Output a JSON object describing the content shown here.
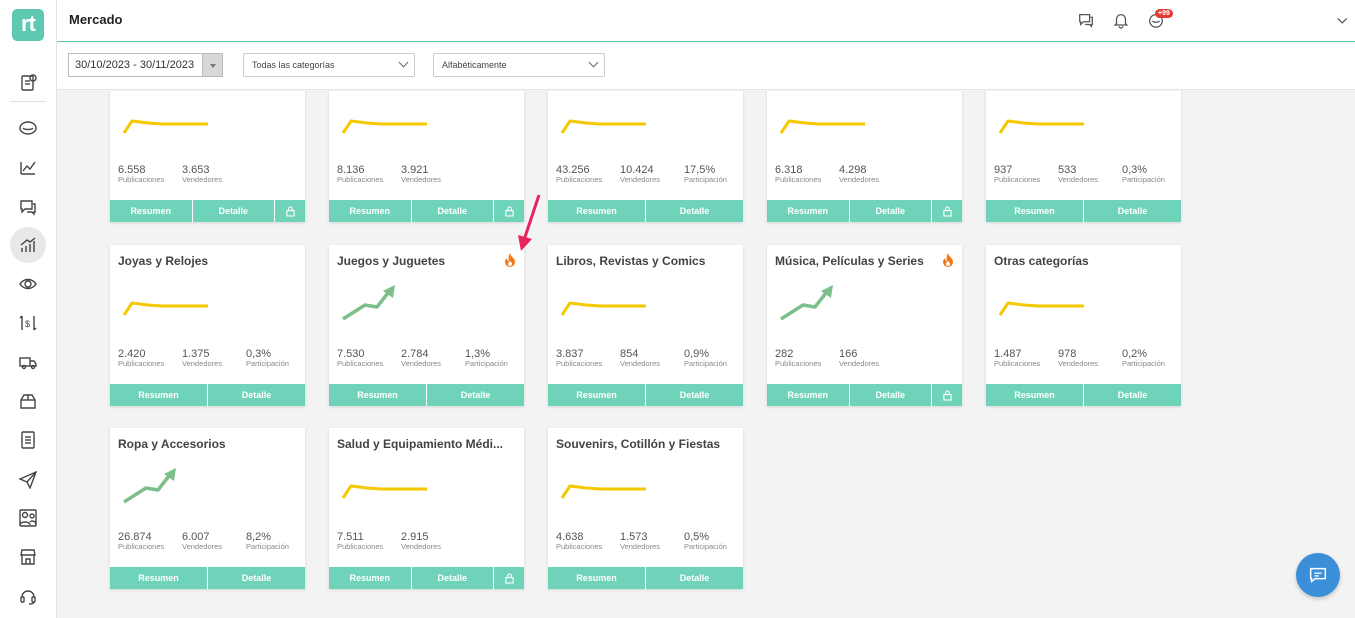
{
  "app": {
    "logo_text": "rt",
    "page_title": "Mercado",
    "notif_badge": "+99"
  },
  "filters": {
    "date_range": "30/10/2023 - 30/11/2023",
    "category": "Todas las categorías",
    "sort": "Alfabéticamente"
  },
  "labels": {
    "pub": "Publicaciones",
    "vend": "Vendedores",
    "part": "Participación",
    "resumen": "Resumen",
    "detalle": "Detalle"
  },
  "colors": {
    "accent": "#6fd3ba",
    "flat_trend": "#f5c800",
    "up_trend": "#7cbf8a",
    "fire": "#f07a1a",
    "annotation": "#e8245e"
  },
  "sidebar": [
    "report-icon",
    "market-icon",
    "chart-icon",
    "chat-icon",
    "trend-icon",
    "eye-icon",
    "price-icon",
    "truck-icon",
    "box-icon",
    "document-icon",
    "send-icon",
    "people-icon",
    "store-icon",
    "support-icon"
  ],
  "cards": [
    {
      "title": "",
      "trend": "flat",
      "pub": "6.558",
      "vend": "3.653",
      "part": "",
      "locked": true,
      "hot": false
    },
    {
      "title": "",
      "trend": "flat",
      "pub": "8.136",
      "vend": "3.921",
      "part": "",
      "locked": true,
      "hot": false
    },
    {
      "title": "",
      "trend": "flat",
      "pub": "43.256",
      "vend": "10.424",
      "part": "17,5%",
      "locked": false,
      "hot": false
    },
    {
      "title": "",
      "trend": "flat",
      "pub": "6.318",
      "vend": "4.298",
      "part": "",
      "locked": true,
      "hot": false
    },
    {
      "title": "",
      "trend": "flat",
      "pub": "937",
      "vend": "533",
      "part": "0,3%",
      "locked": false,
      "hot": false
    },
    {
      "title": "Joyas y Relojes",
      "trend": "flat",
      "pub": "2.420",
      "vend": "1.375",
      "part": "0,3%",
      "locked": false,
      "hot": false
    },
    {
      "title": "Juegos y Juguetes",
      "trend": "up",
      "pub": "7.530",
      "vend": "2.784",
      "part": "1,3%",
      "locked": false,
      "hot": true
    },
    {
      "title": "Libros, Revistas y Comics",
      "trend": "flat",
      "pub": "3.837",
      "vend": "854",
      "part": "0,9%",
      "locked": false,
      "hot": false
    },
    {
      "title": "Música, Películas y Series",
      "trend": "up",
      "pub": "282",
      "vend": "166",
      "part": "",
      "locked": true,
      "hot": true
    },
    {
      "title": "Otras categorías",
      "trend": "flat",
      "pub": "1.487",
      "vend": "978",
      "part": "0,2%",
      "locked": false,
      "hot": false
    },
    {
      "title": "Ropa y Accesorios",
      "trend": "up",
      "pub": "26.874",
      "vend": "6.007",
      "part": "8,2%",
      "locked": false,
      "hot": false
    },
    {
      "title": "Salud y Equipamiento Médi...",
      "trend": "flat",
      "pub": "7.511",
      "vend": "2.915",
      "part": "",
      "locked": true,
      "hot": false
    },
    {
      "title": "Souvenirs, Cotillón y Fiestas",
      "trend": "flat",
      "pub": "4.638",
      "vend": "1.573",
      "part": "0,5%",
      "locked": false,
      "hot": false
    }
  ]
}
